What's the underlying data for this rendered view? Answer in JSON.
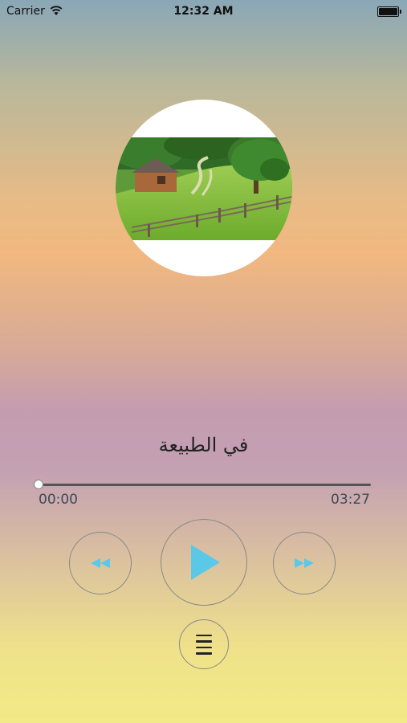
{
  "status_bar": {
    "carrier": "Carrier",
    "time": "12:32 AM",
    "icons": [
      "wifi-icon",
      "battery-icon"
    ]
  },
  "player": {
    "track_title": "في الطبيعة",
    "current_time": "00:00",
    "total_time": "03:27",
    "progress": 0.0,
    "accent_color": "#5bc8e8",
    "controls": [
      "rewind-icon",
      "play-icon",
      "fast-forward-icon",
      "playlist-menu-icon"
    ]
  }
}
